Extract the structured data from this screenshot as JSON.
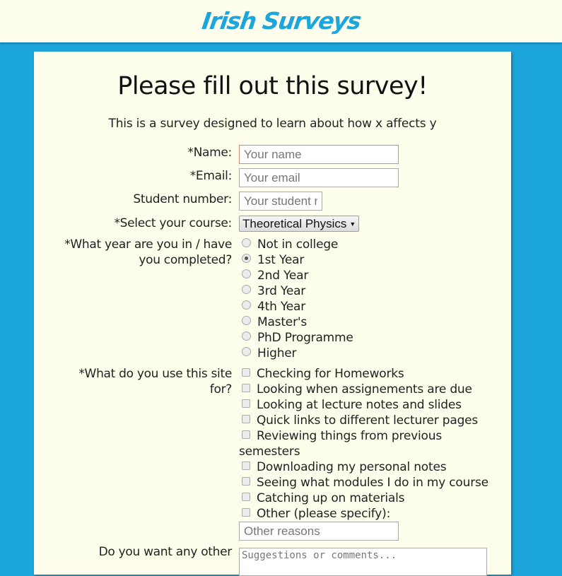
{
  "site": {
    "logo": "Irish Surveys"
  },
  "survey": {
    "title": "Please fill out this survey!",
    "description": "This is a survey designed to learn about how x affects y",
    "name": {
      "label": "*Name:",
      "placeholder": "Your name",
      "value": ""
    },
    "email": {
      "label": "*Email:",
      "placeholder": "Your email",
      "value": ""
    },
    "student_number": {
      "label": "Student number:",
      "placeholder": "Your student number",
      "value": ""
    },
    "course": {
      "label": "*Select your course:",
      "selected": "Theoretical Physics"
    },
    "year": {
      "label_line1": "*What year are you in / have",
      "label_line2": "you completed?",
      "options": [
        {
          "label": "Not in college",
          "checked": false
        },
        {
          "label": "1st Year",
          "checked": true
        },
        {
          "label": "2nd Year",
          "checked": false
        },
        {
          "label": "3rd Year",
          "checked": false
        },
        {
          "label": "4th Year",
          "checked": false
        },
        {
          "label": "Master's",
          "checked": false
        },
        {
          "label": "PhD Programme",
          "checked": false
        },
        {
          "label": "Higher",
          "checked": false
        }
      ]
    },
    "usage": {
      "label_line1": "*What do you use this site",
      "label_line2": "for?",
      "options": [
        {
          "label": "Checking for Homeworks",
          "checked": false
        },
        {
          "label": "Looking when assignements are due",
          "checked": false
        },
        {
          "label": "Looking at lecture notes and slides",
          "checked": false
        },
        {
          "label": "Quick links to different lecturer pages",
          "checked": false
        },
        {
          "label": "Reviewing things from previous",
          "label_cont": "semesters",
          "checked": false
        },
        {
          "label": "Downloading my personal notes",
          "checked": false
        },
        {
          "label": "Seeing what modules I do in my course",
          "checked": false
        },
        {
          "label": "Catching up on materials",
          "checked": false
        },
        {
          "label": "Other (please specify):",
          "checked": false
        }
      ],
      "other_placeholder": "Other reasons"
    },
    "comments": {
      "label": "Do you want any other",
      "placeholder": "Suggestions or comments..."
    }
  }
}
